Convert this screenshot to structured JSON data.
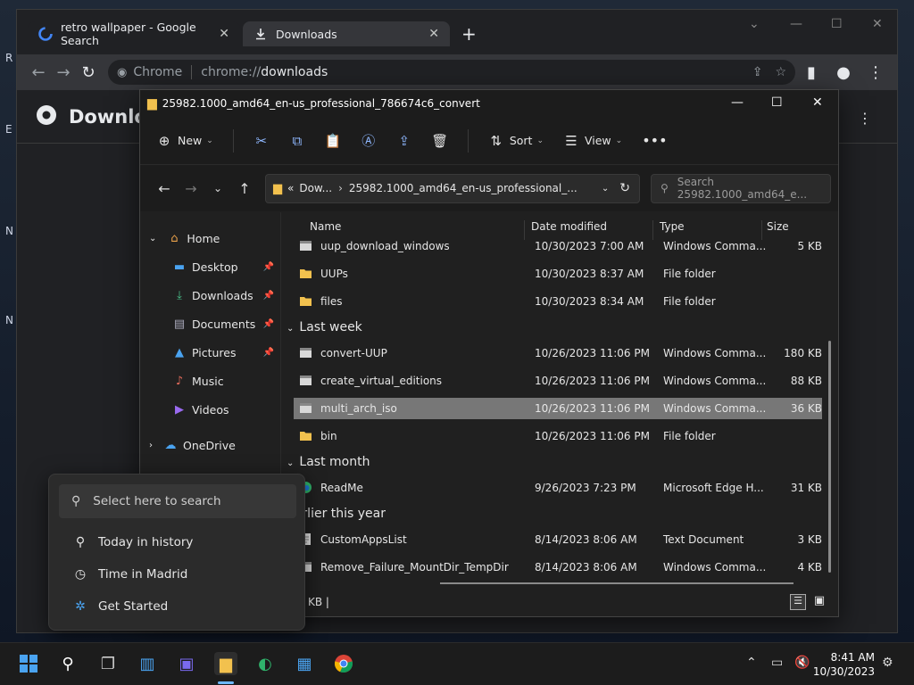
{
  "chrome": {
    "tabs": [
      {
        "label": "retro wallpaper - Google Search",
        "icon": "google-icon"
      },
      {
        "label": "Downloads",
        "icon": "download-icon"
      }
    ],
    "omnibox": {
      "site": "Chrome",
      "url_host": "chrome://",
      "url_path": "downloads"
    },
    "page_title": "Downlo"
  },
  "explorer": {
    "title": "25982.1000_amd64_en-us_professional_786674c6_convert",
    "commands": {
      "new": "New",
      "sort": "Sort",
      "view": "View"
    },
    "address": {
      "parent": "Dow...",
      "current": "25982.1000_amd64_en-us_professional_..."
    },
    "search_placeholder": "Search 25982.1000_amd64_e...",
    "nav": [
      {
        "label": "Home"
      },
      {
        "label": "Desktop"
      },
      {
        "label": "Downloads"
      },
      {
        "label": "Documents"
      },
      {
        "label": "Pictures"
      },
      {
        "label": "Music"
      },
      {
        "label": "Videos"
      },
      {
        "label": "OneDrive"
      }
    ],
    "columns": {
      "name": "Name",
      "date": "Date modified",
      "type": "Type",
      "size": "Size"
    },
    "groups": {
      "last_week": "Last week",
      "last_month": "Last month",
      "earlier": "Earlier this year"
    },
    "files": [
      {
        "name": "uup_download_windows",
        "date": "10/30/2023 7:00 AM",
        "type": "Windows Comma...",
        "size": "5 KB",
        "icon": "cmd"
      },
      {
        "name": "UUPs",
        "date": "10/30/2023 8:37 AM",
        "type": "File folder",
        "size": "",
        "icon": "folder"
      },
      {
        "name": "files",
        "date": "10/30/2023 8:34 AM",
        "type": "File folder",
        "size": "",
        "icon": "folder"
      },
      {
        "name": "convert-UUP",
        "date": "10/26/2023 11:06 PM",
        "type": "Windows Comma...",
        "size": "180 KB",
        "icon": "cmd"
      },
      {
        "name": "create_virtual_editions",
        "date": "10/26/2023 11:06 PM",
        "type": "Windows Comma...",
        "size": "88 KB",
        "icon": "cmd"
      },
      {
        "name": "multi_arch_iso",
        "date": "10/26/2023 11:06 PM",
        "type": "Windows Comma...",
        "size": "36 KB",
        "icon": "cmd"
      },
      {
        "name": "bin",
        "date": "10/26/2023 11:06 PM",
        "type": "File folder",
        "size": "",
        "icon": "folder"
      },
      {
        "name": "ReadMe",
        "date": "9/26/2023 7:23 PM",
        "type": "Microsoft Edge H...",
        "size": "31 KB",
        "icon": "edge"
      },
      {
        "name": "CustomAppsList",
        "date": "8/14/2023 8:06 AM",
        "type": "Text Document",
        "size": "3 KB",
        "icon": "txt"
      },
      {
        "name": "Remove_Failure_MountDir_TempDir",
        "date": "8/14/2023 8:06 AM",
        "type": "Windows Comma...",
        "size": "4 KB",
        "icon": "cmd"
      }
    ],
    "status": "KB  |"
  },
  "flyout": {
    "search_placeholder": "Select here to search",
    "items": [
      {
        "label": "Today in history"
      },
      {
        "label": "Time in Madrid"
      },
      {
        "label": "Get Started"
      }
    ]
  },
  "taskbar": {
    "time": "8:41 AM",
    "date": "10/30/2023"
  },
  "colors": {
    "accent": "#6cb8ff",
    "folder": "#f2c14e",
    "selection": "#777777"
  }
}
